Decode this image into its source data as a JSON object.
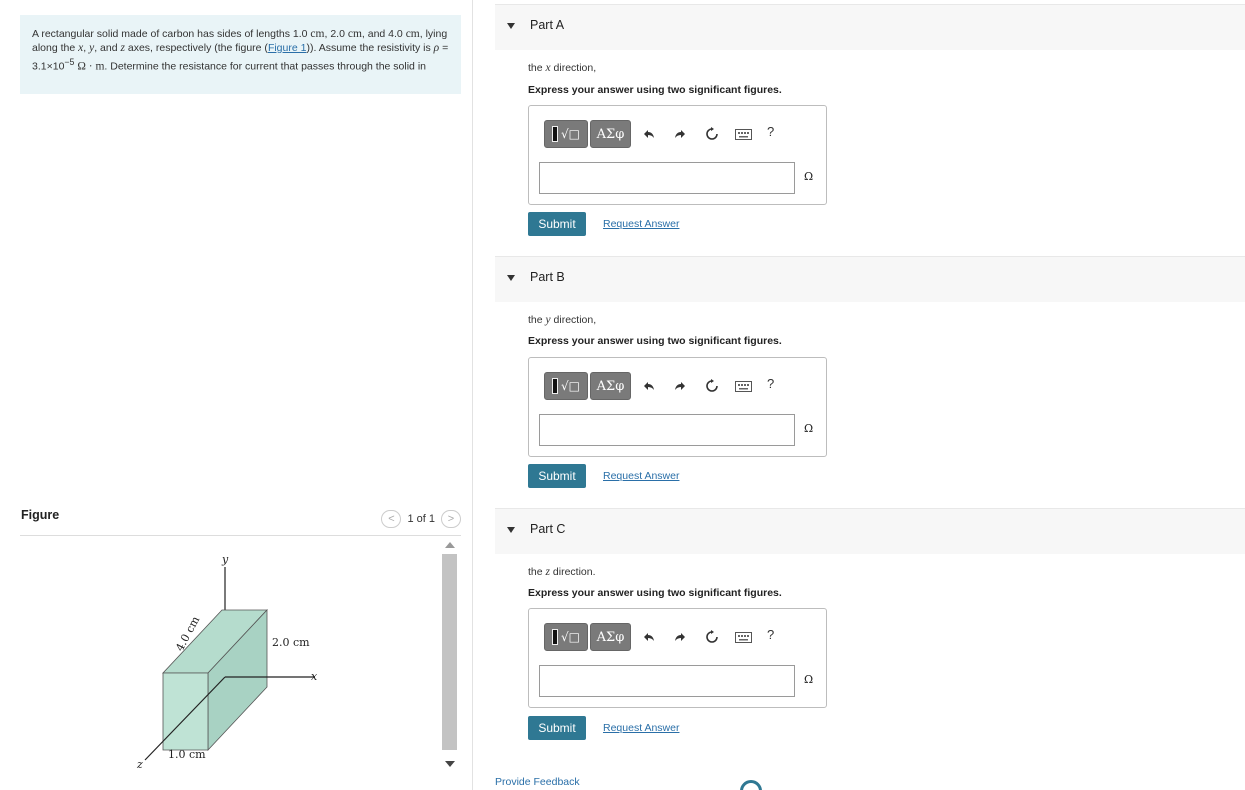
{
  "problem": {
    "text_1": "A rectangular solid made of carbon has sides of lengths 1.0 ",
    "unit_cm": "cm",
    "text_2": ", 2.0 ",
    "text_3": ", and 4.0 ",
    "text_4": ", lying along the ",
    "var_x": "x",
    "comma": ", ",
    "var_y": "y",
    "text_5": ", and ",
    "var_z": "z",
    "text_6": " axes, respectively (the figure (",
    "figure_link": "Figure 1",
    "text_7": ")). Assume the resistivity is ",
    "rho": "ρ",
    "text_8": " = 3.1×10",
    "exponent": "−5",
    "unit_ohm_m": "Ω · m",
    "text_9": ". Determine the resistance for current that passes through the solid in"
  },
  "figure": {
    "title": "Figure",
    "page_label": "1 of 1",
    "prev_symbol": "<",
    "next_symbol": ">",
    "label_y": "y",
    "label_x": "x",
    "label_z": "z",
    "label_4cm": "4.0 cm",
    "label_2cm": "2.0 cm",
    "label_1cm": "1.0 cm",
    "solid_fill": "#b5dccd"
  },
  "parts": [
    {
      "title": "Part A",
      "prompt_pre": "the ",
      "prompt_var": "x",
      "prompt_post": " direction,",
      "instruction": "Express your answer using two significant figures.",
      "answer_value": "",
      "unit": "Ω",
      "submit_label": "Submit",
      "request_label": "Request Answer"
    },
    {
      "title": "Part B",
      "prompt_pre": "the ",
      "prompt_var": "y",
      "prompt_post": " direction,",
      "instruction": "Express your answer using two significant figures.",
      "answer_value": "",
      "unit": "Ω",
      "submit_label": "Submit",
      "request_label": "Request Answer"
    },
    {
      "title": "Part C",
      "prompt_pre": "the ",
      "prompt_var": "z",
      "prompt_post": " direction.",
      "instruction": "Express your answer using two significant figures.",
      "answer_value": "",
      "unit": "Ω",
      "submit_label": "Submit",
      "request_label": "Request Answer"
    }
  ],
  "toolbar": {
    "greek_label": "ΑΣφ",
    "help_label": "?",
    "icons": [
      "templates-icon",
      "undo-icon",
      "redo-icon",
      "reset-icon",
      "keyboard-icon",
      "help-icon"
    ]
  },
  "footer": {
    "feedback_label": "Provide Feedback"
  },
  "colors": {
    "problem_bg": "#e9f4f7",
    "submit_bg": "#2f7893",
    "link": "#2a6fa8"
  }
}
